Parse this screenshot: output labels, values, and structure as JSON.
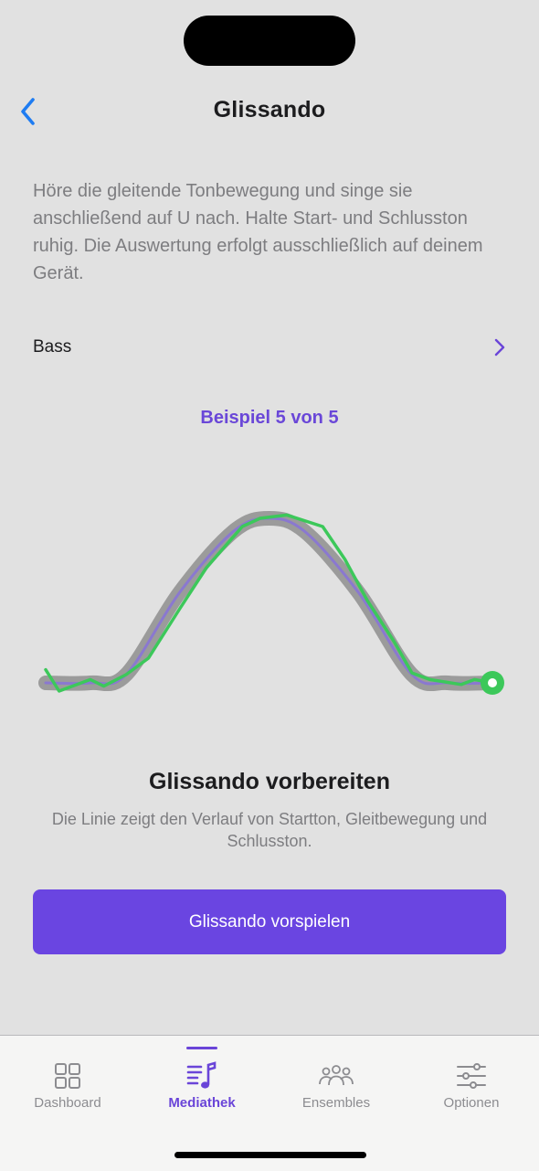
{
  "nav": {
    "title": "Glissando",
    "back_icon": "chevron-left-icon"
  },
  "intro": "Höre die gleitende Tonbewegung und singe sie anschließend auf U nach. Halte Start- und Schlusston ruhig. Die Auswertung erfolgt ausschließlich auf deinem Gerät.",
  "voice": {
    "label": "Bass",
    "icon": "chevron-right-icon"
  },
  "example_label": "Beispiel 5 von 5",
  "graph": {
    "target_color": "#9b9b9b",
    "reference_color": "#8a78d0",
    "sung_color": "#3cc85a",
    "reference_curve": [
      [
        0,
        0
      ],
      [
        0.1,
        0
      ],
      [
        0.18,
        0.05
      ],
      [
        0.3,
        0.55
      ],
      [
        0.42,
        0.92
      ],
      [
        0.5,
        1
      ],
      [
        0.58,
        0.92
      ],
      [
        0.7,
        0.55
      ],
      [
        0.82,
        0.05
      ],
      [
        0.9,
        0
      ],
      [
        1,
        0
      ]
    ],
    "sung_curve": [
      [
        0,
        0.08
      ],
      [
        0.03,
        -0.05
      ],
      [
        0.1,
        0.02
      ],
      [
        0.13,
        -0.02
      ],
      [
        0.18,
        0.05
      ],
      [
        0.23,
        0.15
      ],
      [
        0.3,
        0.45
      ],
      [
        0.36,
        0.7
      ],
      [
        0.44,
        0.95
      ],
      [
        0.48,
        1
      ],
      [
        0.54,
        1.02
      ],
      [
        0.62,
        0.95
      ],
      [
        0.67,
        0.75
      ],
      [
        0.72,
        0.5
      ],
      [
        0.78,
        0.25
      ],
      [
        0.82,
        0.06
      ],
      [
        0.86,
        0.02
      ],
      [
        0.93,
        -0.01
      ],
      [
        0.96,
        0.02
      ],
      [
        1,
        0
      ]
    ]
  },
  "prepare": {
    "title": "Glissando vorbereiten",
    "description": "Die Linie zeigt den Verlauf von Startton, Gleitbewegung und Schlusston."
  },
  "play_button": "Glissando vorspielen",
  "tabs": [
    {
      "label": "Dashboard",
      "icon": "grid-icon",
      "active": false
    },
    {
      "label": "Mediathek",
      "icon": "music-library-icon",
      "active": true
    },
    {
      "label": "Ensembles",
      "icon": "group-icon",
      "active": false
    },
    {
      "label": "Optionen",
      "icon": "sliders-icon",
      "active": false
    }
  ],
  "colors": {
    "accent": "#6a45e1",
    "back": "#1e7cf2",
    "background": "#e1e1e1"
  }
}
